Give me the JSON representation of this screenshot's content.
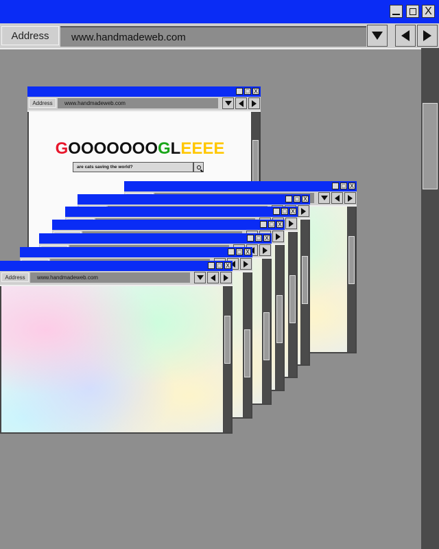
{
  "main": {
    "address_label": "Address",
    "url": "www.handmadeweb.com",
    "close_label": "X"
  },
  "mini": {
    "address_label": "Address",
    "url": "www.handmadeweb.com",
    "close_label": "X"
  },
  "google": {
    "logo_letters": [
      {
        "ch": "G",
        "color": "#e8172c"
      },
      {
        "ch": "O",
        "color": "#111111"
      },
      {
        "ch": "O",
        "color": "#111111"
      },
      {
        "ch": "O",
        "color": "#111111"
      },
      {
        "ch": "O",
        "color": "#111111"
      },
      {
        "ch": "O",
        "color": "#111111"
      },
      {
        "ch": "O",
        "color": "#111111"
      },
      {
        "ch": "O",
        "color": "#111111"
      },
      {
        "ch": "G",
        "color": "#1aa61a"
      },
      {
        "ch": "L",
        "color": "#111111"
      },
      {
        "ch": "E",
        "color": "#ffc700"
      },
      {
        "ch": "E",
        "color": "#ffc700"
      },
      {
        "ch": "E",
        "color": "#ffc700"
      },
      {
        "ch": "E",
        "color": "#ffc700"
      }
    ],
    "search_query": "are cats saving the world?"
  },
  "colors": {
    "titlebar": "#0a2cf5",
    "desktop": "#8e8e8e"
  }
}
